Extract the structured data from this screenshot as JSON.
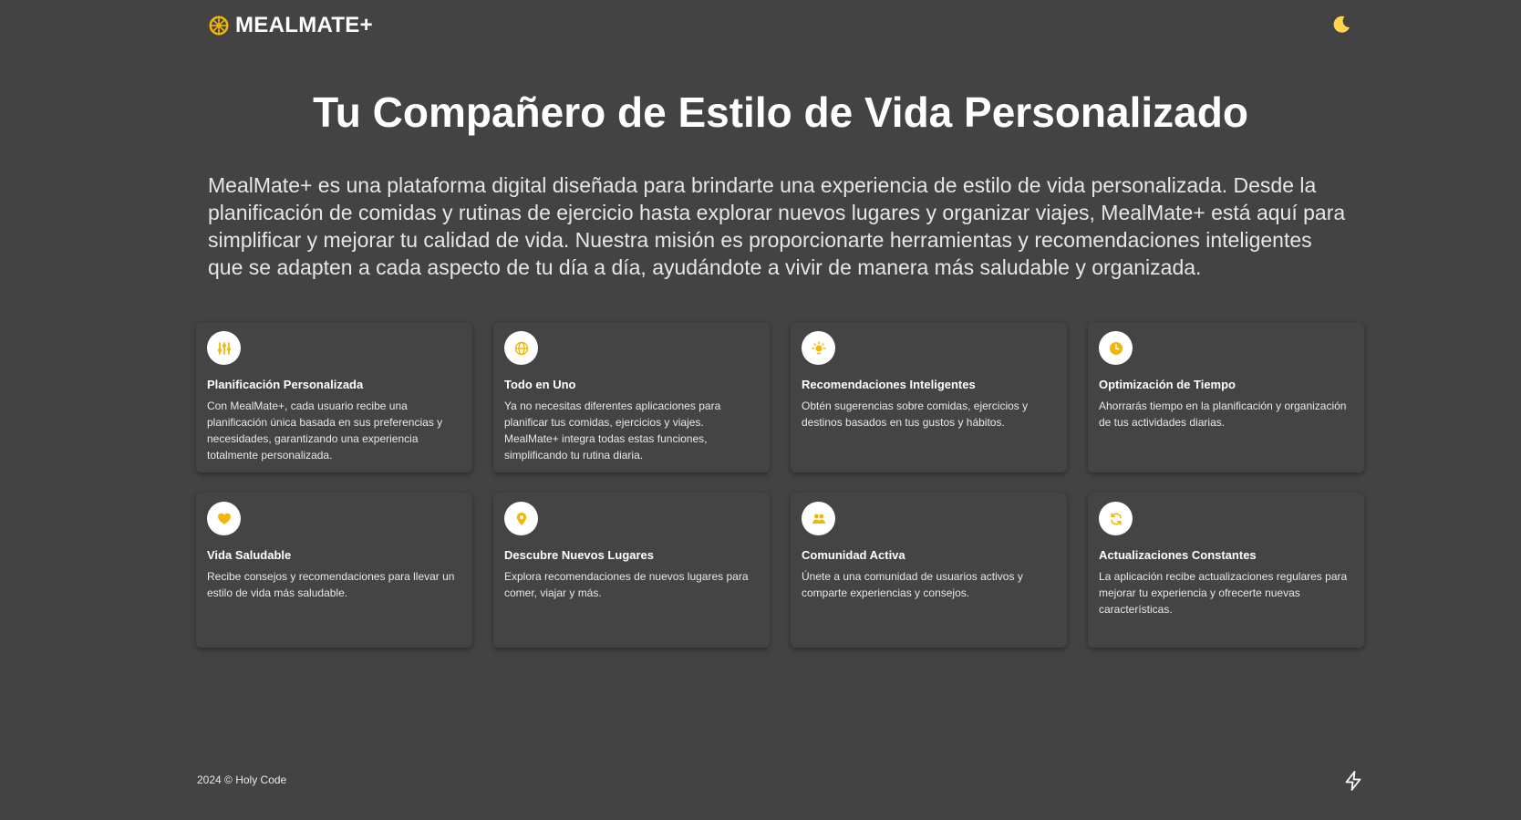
{
  "header": {
    "logo_text": "MEALMATE+",
    "logo_icon": "citrus-slice-icon",
    "theme_toggle_icon": "moon-icon"
  },
  "hero": {
    "title": "Tu Compañero de Estilo de Vida Personalizado",
    "description": "MealMate+ es una plataforma digital diseñada para brindarte una experiencia de estilo de vida personalizada. Desde la planificación de comidas y rutinas de ejercicio hasta explorar nuevos lugares y organizar viajes, MealMate+ está aquí para simplificar y mejorar tu calidad de vida. Nuestra misión es proporcionarte herramientas y recomendaciones inteligentes que se adapten a cada aspecto de tu día a día, ayudándote a vivir de manera más saludable y organizada."
  },
  "features": [
    {
      "icon": "sliders-icon",
      "title": "Planificación Personalizada",
      "text": "Con MealMate+, cada usuario recibe una planificación única basada en sus preferencias y necesidades, garantizando una experiencia totalmente personalizada."
    },
    {
      "icon": "globe-icon",
      "title": "Todo en Uno",
      "text": "Ya no necesitas diferentes aplicaciones para planificar tus comidas, ejercicios y viajes. MealMate+ integra todas estas funciones, simplificando tu rutina diaria."
    },
    {
      "icon": "lightbulb-icon",
      "title": "Recomendaciones Inteligentes",
      "text": "Obtén sugerencias sobre comidas, ejercicios y destinos basados en tus gustos y hábitos."
    },
    {
      "icon": "clock-icon",
      "title": "Optimización de Tiempo",
      "text": "Ahorrarás tiempo en la planificación y organización de tus actividades diarias."
    },
    {
      "icon": "heart-icon",
      "title": "Vida Saludable",
      "text": "Recibe consejos y recomendaciones para llevar un estilo de vida más saludable."
    },
    {
      "icon": "map-pin-icon",
      "title": "Descubre Nuevos Lugares",
      "text": "Explora recomendaciones de nuevos lugares para comer, viajar y más."
    },
    {
      "icon": "users-icon",
      "title": "Comunidad Activa",
      "text": "Únete a una comunidad de usuarios activos y comparte experiencias y consejos."
    },
    {
      "icon": "refresh-icon",
      "title": "Actualizaciones Constantes",
      "text": "La aplicación recibe actualizaciones regulares para mejorar tu experiencia y ofrecerte nuevas características."
    }
  ],
  "footer": {
    "copyright": "2024 © Holy Code",
    "icon": "lightning-bolt-icon"
  },
  "colors": {
    "background": "#434343",
    "accent": "#f2b705",
    "moon": "#ffd54f"
  }
}
